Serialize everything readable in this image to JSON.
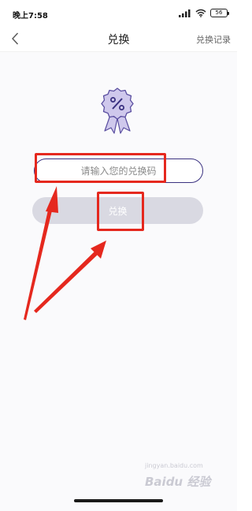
{
  "status_bar": {
    "time": "晚上7:58",
    "battery": "56"
  },
  "nav": {
    "title": "兑换",
    "history_label": "兑换记录"
  },
  "redeem": {
    "input_placeholder": "请输入您的兑换码",
    "input_value": "",
    "button_label": "兑换"
  },
  "icons": {
    "back": "chevron-left-icon",
    "badge": "discount-badge-icon",
    "signal": "signal-icon",
    "wifi": "wifi-icon",
    "battery": "battery-icon"
  },
  "colors": {
    "accent": "#3a3180",
    "badge_fill": "#cfc8ec",
    "badge_stroke": "#5a4ea0",
    "button_disabled": "#d9d9e2",
    "annotation": "#e5281e"
  },
  "watermark": {
    "url": "jingyan.baidu.com",
    "brand": "Baidu 经验"
  }
}
